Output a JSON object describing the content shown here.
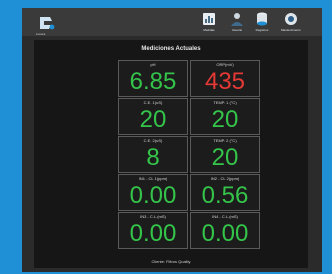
{
  "colors": {
    "accent": "#1f8fd6",
    "value_green": "#34c44a",
    "value_red": "#e53935"
  },
  "app": {
    "logo_label": "Lunera"
  },
  "nav": [
    {
      "icon": "dashboard-icon",
      "label": "Medidas"
    },
    {
      "icon": "user-icon",
      "label": "Usuario"
    },
    {
      "icon": "database-icon",
      "label": "Registros"
    },
    {
      "icon": "settings-icon",
      "label": "Mantenimiento"
    }
  ],
  "section_title": "Mediciones Actuales",
  "readings": [
    {
      "label": "pH",
      "value": "6.85"
    },
    {
      "label": "ORP(mV)",
      "value": "435"
    },
    {
      "label": "C.E. 1(uS)",
      "value": "20"
    },
    {
      "label": "TEMP. 1 (°C)",
      "value": "20"
    },
    {
      "label": "C.E. 2(uS)",
      "value": "8"
    },
    {
      "label": "TEMP. 2 (°C)",
      "value": "20"
    },
    {
      "label": "IN1 - CL 1(ppm)",
      "value": "0.00"
    },
    {
      "label": "IN2 - CL 2(ppm)",
      "value": "0.56"
    },
    {
      "label": "IN3 - C.L.(mS)",
      "value": "0.00"
    },
    {
      "label": "IN4 - C.L.(mS)",
      "value": "0.00"
    }
  ],
  "footer": "Cliente: Filtros Quality"
}
